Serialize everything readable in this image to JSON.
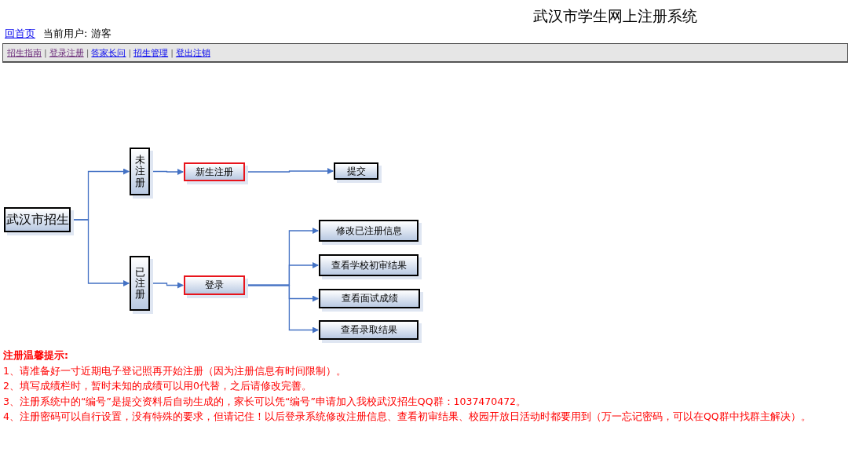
{
  "title": "武汉市学生网上注册系统",
  "home_link": "回首页",
  "current_user": "当前用户: 游客",
  "nav": [
    {
      "label": "招生指南",
      "visited": true
    },
    {
      "label": "登录注册",
      "visited": true
    },
    {
      "label": "答家长问",
      "visited": false
    },
    {
      "label": "招生管理",
      "visited": false
    },
    {
      "label": "登出注销",
      "visited": false
    }
  ],
  "nav_separator": "|",
  "diagram": {
    "root": {
      "label": "武汉市招生",
      "highlighted": false,
      "children": [
        {
          "label": "未注册",
          "vertical": true,
          "highlighted": false,
          "children": [
            {
              "label": "新生注册",
              "highlighted": true,
              "children": [
                {
                  "label": "提交",
                  "highlighted": false
                }
              ]
            }
          ]
        },
        {
          "label": "已注册",
          "vertical": true,
          "highlighted": false,
          "children": [
            {
              "label": "登录",
              "highlighted": true,
              "children": [
                {
                  "label": "修改已注册信息",
                  "highlighted": false
                },
                {
                  "label": "查看学校初审结果",
                  "highlighted": false
                },
                {
                  "label": "查看面试成绩",
                  "highlighted": false
                },
                {
                  "label": "查看录取结果",
                  "highlighted": false
                }
              ]
            }
          ]
        }
      ]
    }
  },
  "notes": {
    "heading": "注册温馨提示:",
    "items": [
      "1、请准备好一寸近期电子登记照再开始注册（因为注册信息有时间限制）。",
      "2、填写成绩栏时，暂时未知的成绩可以用0代替，之后请修改完善。",
      "3、注册系统中的“编号”是提交资料后自动生成的，家长可以凭“编号”申请加入我校武汉招生QQ群：1037470472。",
      "4、注册密码可以自行设置，没有特殊的要求，但请记住！以后登录系统修改注册信息、查看初审结果、校园开放日活动时都要用到（万一忘记密码，可以在QQ群中找群主解决）。"
    ]
  }
}
